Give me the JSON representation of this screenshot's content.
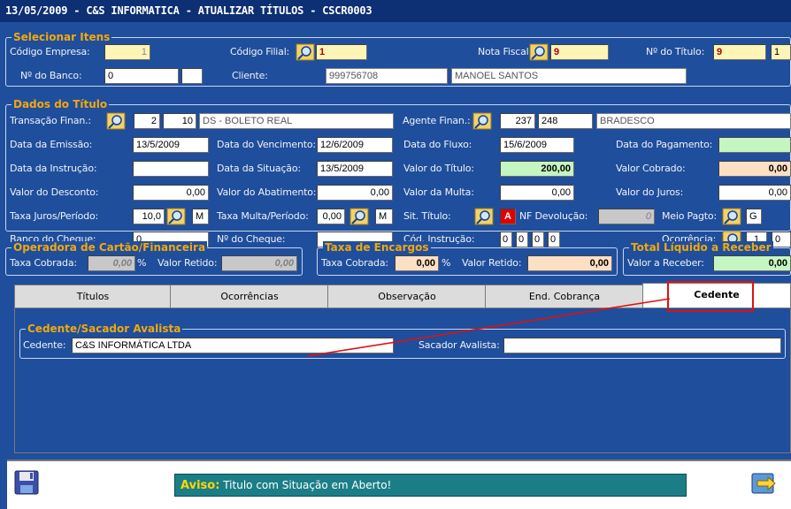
{
  "window_title": "13/05/2009 - C&S INFORMATICA - ATUALIZAR TÍTULOS - CSCR0003",
  "sel": {
    "title": "Selecionar Itens",
    "codigo_empresa_label": "Código Empresa:",
    "codigo_empresa": "1",
    "codigo_filial_label": "Código Filial:",
    "codigo_filial": "1",
    "nota_fiscal_label": "Nota Fiscal:",
    "nota_fiscal": "9",
    "num_titulo_label": "Nº do Título:",
    "num_titulo": "9",
    "num_titulo_seq": "1",
    "num_banco_label": "Nº do Banco:",
    "num_banco": "0",
    "num_banco_aux": "",
    "cliente_label": "Cliente:",
    "cliente_code": "999756708",
    "cliente_name": "MANOEL SANTOS"
  },
  "dados": {
    "title": "Dados do Título",
    "transacao_label": "Transação Finan.:",
    "transacao_a": "2",
    "transacao_b": "10",
    "transacao_desc": "DS - BOLETO REAL",
    "agente_label": "Agente Finan.:",
    "agente_a": "237",
    "agente_b": "248",
    "agente_desc": "BRADESCO",
    "data_emissao_label": "Data  da Emissão:",
    "data_emissao": "13/5/2009",
    "data_venc_label": "Data do Vencimento:",
    "data_venc": "12/6/2009",
    "data_fluxo_label": "Data do Fluxo:",
    "data_fluxo": "15/6/2009",
    "data_pag_label": "Data do Pagamento:",
    "data_pag": "",
    "data_instr_label": "Data da Instrução:",
    "data_instr": "",
    "data_sit_label": "Data da Situação:",
    "data_sit": "13/5/2009",
    "valor_titulo_label": "Valor do Título:",
    "valor_titulo": "200,00",
    "valor_cobrado_label": "Valor Cobrado:",
    "valor_cobrado": "0,00",
    "valor_desc_label": "Valor do Desconto:",
    "valor_desc": "0,00",
    "valor_abat_label": "Valor do Abatimento:",
    "valor_abat": "0,00",
    "valor_multa_label": "Valor da Multa:",
    "valor_multa": "0,00",
    "valor_juros_label": "Valor do Juros:",
    "valor_juros": "0,00",
    "taxa_juros_label": "Taxa Juros/Período:",
    "taxa_juros": "10,0",
    "taxa_juros_p": "M",
    "taxa_multa_label": "Taxa Multa/Período:",
    "taxa_multa": "0,00",
    "taxa_multa_p": "M",
    "sit_titulo_label": "Sit. Título:",
    "sit_titulo": "A",
    "nf_devol_label": "NF Devolução:",
    "nf_devol": "0",
    "meio_pagto_label": "Meio Pagto:",
    "meio_pagto": "G",
    "banco_cheque_label": "Banco do Cheque:",
    "banco_cheque": "0",
    "num_cheque_label": "Nº do Cheque:",
    "num_cheque": "",
    "cod_instr_label": "Cód. Instrução:",
    "cod_instr": [
      "0",
      "0",
      "0",
      "0"
    ],
    "ocorrencia_label": "Ocorrência:",
    "ocorrencia_a": "1",
    "ocorrencia_b": "0"
  },
  "operadora": {
    "title": "Operadora de Cartão/Financeira",
    "taxa_label": "Taxa Cobrada:",
    "taxa": "0,00",
    "pct": "%",
    "retido_label": "Valor Retido:",
    "retido": "0,00"
  },
  "encargos": {
    "title": "Taxa de Encargos",
    "taxa_label": "Taxa Cobrada:",
    "taxa": "0,00",
    "pct": "%",
    "retido_label": "Valor Retido:",
    "retido": "0,00"
  },
  "total": {
    "title": "Total Líquido a Receber",
    "valor_label": "Valor a Receber:",
    "valor": "0,00"
  },
  "tabs": [
    "Títulos",
    "Ocorrências",
    "Observação",
    "End. Cobrança",
    "Cedente"
  ],
  "cedente": {
    "title": "Cedente/Sacador Avalista",
    "cedente_label": "Cedente:",
    "cedente": "C&S INFORMÁTICA LTDA",
    "sacador_label": "Sacador Avalista:",
    "sacador": ""
  },
  "status": {
    "key": "Aviso:",
    "text": " Titulo com Situação em Aberto!"
  },
  "colors": {
    "bg": "#1f4e9c",
    "title": "#0d2f73",
    "group_title": "#f2a80c",
    "annotation": "#e01010"
  }
}
